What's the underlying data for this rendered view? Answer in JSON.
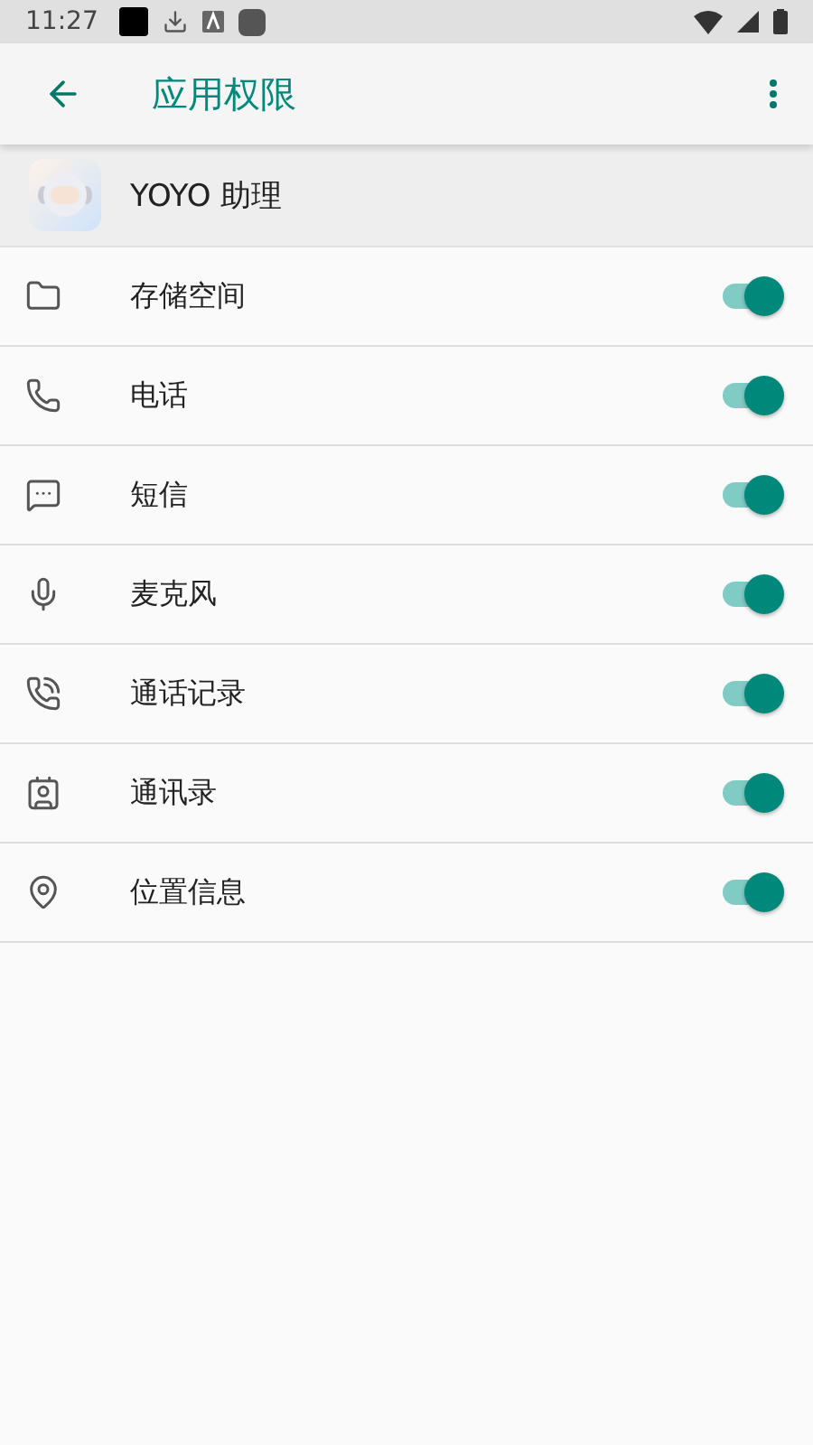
{
  "status_bar": {
    "time": "11:27"
  },
  "app_bar": {
    "title": "应用权限"
  },
  "app": {
    "name": "YOYO 助理"
  },
  "permissions": [
    {
      "label": "存储空间",
      "on": true
    },
    {
      "label": "电话",
      "on": true
    },
    {
      "label": "短信",
      "on": true
    },
    {
      "label": "麦克风",
      "on": true
    },
    {
      "label": "通话记录",
      "on": true
    },
    {
      "label": "通讯录",
      "on": true
    },
    {
      "label": "位置信息",
      "on": true
    }
  ]
}
